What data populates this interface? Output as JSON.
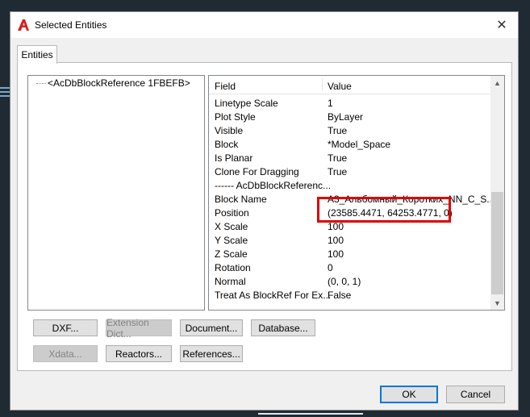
{
  "window": {
    "title": "Selected Entities",
    "close_glyph": "✕",
    "app_icon": "autocad-a-icon"
  },
  "tabs": [
    {
      "label": "Entities"
    }
  ],
  "tree": {
    "item_label": "<AcDbBlockReference   1FBEFB>"
  },
  "properties": {
    "header_field": "Field",
    "header_value": "Value",
    "rows": [
      {
        "field": "Linetype Scale",
        "value": "1"
      },
      {
        "field": "Plot Style",
        "value": "ByLayer"
      },
      {
        "field": "Visible",
        "value": "True"
      },
      {
        "field": "Block",
        "value": "*Model_Space"
      },
      {
        "field": "Is Planar",
        "value": "True"
      },
      {
        "field": "Clone For Dragging",
        "value": "True"
      },
      {
        "field": "------ AcDbBlockReferenc...",
        "value": ""
      },
      {
        "field": "Block Name",
        "value": "A3_Альбомный_Коротких_NN_C_S..."
      },
      {
        "field": "Position",
        "value": "(23585.4471, 64253.4771, 0)"
      },
      {
        "field": "X Scale",
        "value": "100"
      },
      {
        "field": "Y Scale",
        "value": "100"
      },
      {
        "field": "Z Scale",
        "value": "100"
      },
      {
        "field": "Rotation",
        "value": "0"
      },
      {
        "field": "Normal",
        "value": "(0, 0, 1)"
      },
      {
        "field": "Treat As BlockRef For Ex...",
        "value": "False"
      }
    ]
  },
  "buttons": {
    "dxf": "DXF...",
    "extension_dict": "Extension Dict...",
    "document": "Document...",
    "database": "Database...",
    "xdata": "Xdata...",
    "reactors": "Reactors...",
    "references": "References...",
    "ok": "OK",
    "cancel": "Cancel"
  },
  "colors": {
    "highlight": "#e00000",
    "ok_border": "#0078d7",
    "dialog_bg": "#f0f0f0"
  }
}
